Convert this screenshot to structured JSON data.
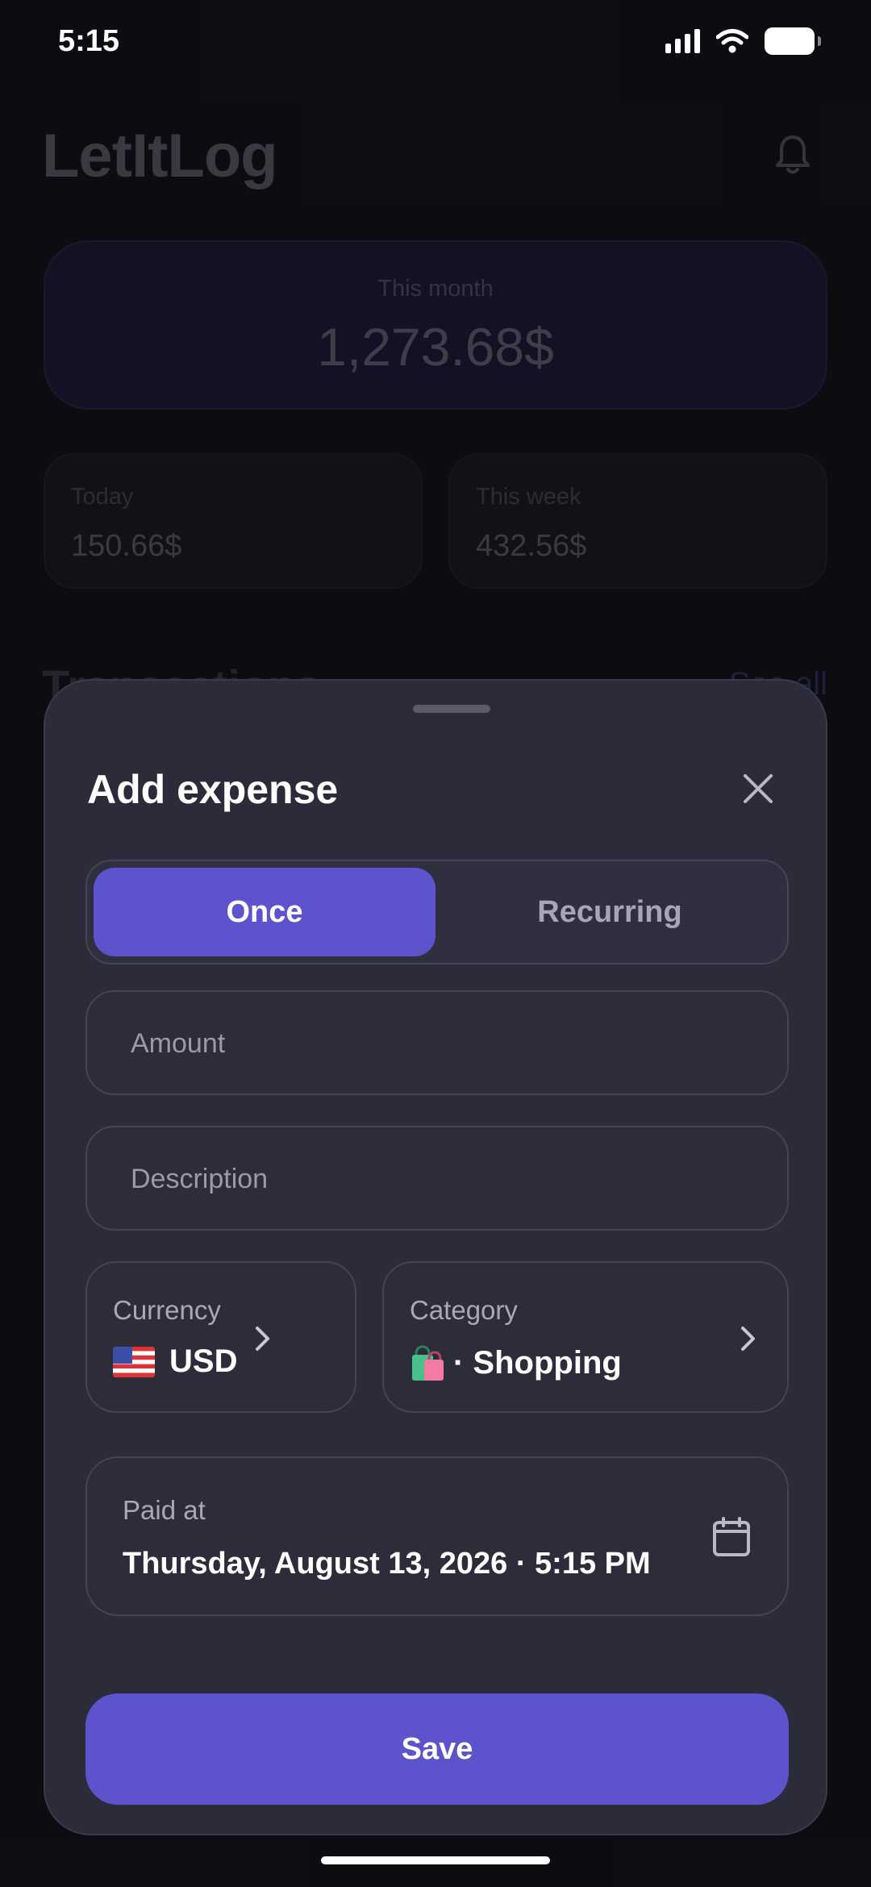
{
  "status_bar": {
    "time": "5:15"
  },
  "header": {
    "app_title": "LetItLog"
  },
  "summary": {
    "month_label": "This month",
    "month_value": "1,273.68$",
    "today_label": "Today",
    "today_value": "150.66$",
    "week_label": "This week",
    "week_value": "432.56$"
  },
  "transactions": {
    "title": "Transactions",
    "see_all": "See all"
  },
  "sheet": {
    "title": "Add expense",
    "tabs": [
      {
        "label": "Once",
        "selected": true
      },
      {
        "label": "Recurring",
        "selected": false
      }
    ],
    "amount": {
      "placeholder": "Amount",
      "value": ""
    },
    "description": {
      "placeholder": "Description",
      "value": ""
    },
    "currency": {
      "label": "Currency",
      "value": "USD",
      "icon": "us-flag-icon"
    },
    "category": {
      "label": "Category",
      "value": "· Shopping",
      "icon": "shopping-bags-icon"
    },
    "paid_at": {
      "label": "Paid at",
      "value": "Thursday, August 13, 2026 · 5:15 PM"
    },
    "save_label": "Save"
  },
  "colors": {
    "accent": "#5d53cc",
    "sheet_bg": "#2b2b3a",
    "page_bg": "#0f0f15"
  }
}
